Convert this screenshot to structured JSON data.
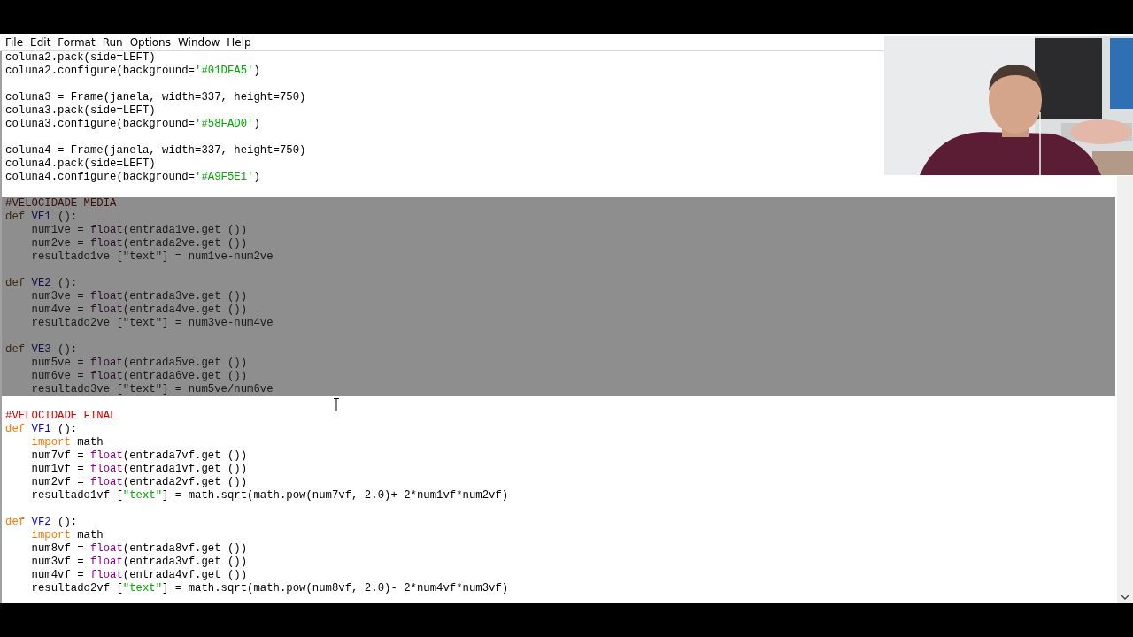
{
  "menu": [
    {
      "label": "File"
    },
    {
      "label": "Edit"
    },
    {
      "label": "Format"
    },
    {
      "label": "Run"
    },
    {
      "label": "Options"
    },
    {
      "label": "Window"
    },
    {
      "label": "Help"
    }
  ],
  "code_lines": [
    {
      "selected": false,
      "tokens": [
        {
          "kind": "plain",
          "text": "coluna2.pack(side=LEFT)"
        }
      ]
    },
    {
      "selected": false,
      "tokens": [
        {
          "kind": "plain",
          "text": "coluna2.configure(background="
        },
        {
          "kind": "string",
          "text": "'#01DFA5'"
        },
        {
          "kind": "plain",
          "text": ")"
        }
      ]
    },
    {
      "selected": false
    },
    {
      "selected": false,
      "tokens": [
        {
          "kind": "plain",
          "text": "coluna3 = Frame(janela, width=337, height=750)"
        }
      ]
    },
    {
      "selected": false,
      "tokens": [
        {
          "kind": "plain",
          "text": "coluna3.pack(side=LEFT)"
        }
      ]
    },
    {
      "selected": false,
      "tokens": [
        {
          "kind": "plain",
          "text": "coluna3.configure(background="
        },
        {
          "kind": "string",
          "text": "'#58FAD0'"
        },
        {
          "kind": "plain",
          "text": ")"
        }
      ]
    },
    {
      "selected": false
    },
    {
      "selected": false,
      "tokens": [
        {
          "kind": "plain",
          "text": "coluna4 = Frame(janela, width=337, height=750)"
        }
      ]
    },
    {
      "selected": false,
      "tokens": [
        {
          "kind": "plain",
          "text": "coluna4.pack(side=LEFT)"
        }
      ]
    },
    {
      "selected": false,
      "tokens": [
        {
          "kind": "plain",
          "text": "coluna4.configure(background="
        },
        {
          "kind": "string",
          "text": "'#A9F5E1'"
        },
        {
          "kind": "plain",
          "text": ")"
        }
      ]
    },
    {
      "selected": false
    },
    {
      "selected": true,
      "tokens": [
        {
          "kind": "comment",
          "text": "#VELOCIDADE MEDIA"
        }
      ]
    },
    {
      "selected": true,
      "tokens": [
        {
          "kind": "keyword",
          "text": "def"
        },
        {
          "kind": "defname",
          "text": " VE1"
        },
        {
          "kind": "plain",
          "text": " ():"
        }
      ]
    },
    {
      "selected": true,
      "tokens": [
        {
          "kind": "plain",
          "text": "    num1ve = "
        },
        {
          "kind": "builtin",
          "text": "float"
        },
        {
          "kind": "plain",
          "text": "(entrada1ve.get ())"
        }
      ]
    },
    {
      "selected": true,
      "tokens": [
        {
          "kind": "plain",
          "text": "    num2ve = "
        },
        {
          "kind": "builtin",
          "text": "float"
        },
        {
          "kind": "plain",
          "text": "(entrada2ve.get ())"
        }
      ]
    },
    {
      "selected": true,
      "tokens": [
        {
          "kind": "plain",
          "text": "    resultado1ve ["
        },
        {
          "kind": "string",
          "text": "\"text\""
        },
        {
          "kind": "plain",
          "text": "] = num1ve-num2ve"
        }
      ]
    },
    {
      "selected": true
    },
    {
      "selected": true,
      "tokens": [
        {
          "kind": "keyword",
          "text": "def"
        },
        {
          "kind": "defname",
          "text": " VE2"
        },
        {
          "kind": "plain",
          "text": " ():"
        }
      ]
    },
    {
      "selected": true,
      "tokens": [
        {
          "kind": "plain",
          "text": "    num3ve = "
        },
        {
          "kind": "builtin",
          "text": "float"
        },
        {
          "kind": "plain",
          "text": "(entrada3ve.get ())"
        }
      ]
    },
    {
      "selected": true,
      "tokens": [
        {
          "kind": "plain",
          "text": "    num4ve = "
        },
        {
          "kind": "builtin",
          "text": "float"
        },
        {
          "kind": "plain",
          "text": "(entrada4ve.get ())"
        }
      ]
    },
    {
      "selected": true,
      "tokens": [
        {
          "kind": "plain",
          "text": "    resultado2ve ["
        },
        {
          "kind": "string",
          "text": "\"text\""
        },
        {
          "kind": "plain",
          "text": "] = num3ve-num4ve"
        }
      ]
    },
    {
      "selected": true
    },
    {
      "selected": true,
      "tokens": [
        {
          "kind": "keyword",
          "text": "def"
        },
        {
          "kind": "defname",
          "text": " VE3"
        },
        {
          "kind": "plain",
          "text": " ():"
        }
      ]
    },
    {
      "selected": true,
      "tokens": [
        {
          "kind": "plain",
          "text": "    num5ve = "
        },
        {
          "kind": "builtin",
          "text": "float"
        },
        {
          "kind": "plain",
          "text": "(entrada5ve.get ())"
        }
      ]
    },
    {
      "selected": true,
      "tokens": [
        {
          "kind": "plain",
          "text": "    num6ve = "
        },
        {
          "kind": "builtin",
          "text": "float"
        },
        {
          "kind": "plain",
          "text": "(entrada6ve.get ())"
        }
      ]
    },
    {
      "selected": true,
      "tokens": [
        {
          "kind": "plain",
          "text": "    resultado3ve ["
        },
        {
          "kind": "string",
          "text": "\"text\""
        },
        {
          "kind": "plain",
          "text": "] = num5ve/num6ve"
        }
      ]
    },
    {
      "selected": false
    },
    {
      "selected": false,
      "tokens": [
        {
          "kind": "comment",
          "text": "#VELOCIDADE FINAL"
        }
      ]
    },
    {
      "selected": false,
      "tokens": [
        {
          "kind": "keyword",
          "text": "def"
        },
        {
          "kind": "defname",
          "text": " VF1"
        },
        {
          "kind": "plain",
          "text": " ():"
        }
      ]
    },
    {
      "selected": false,
      "tokens": [
        {
          "kind": "keyword",
          "text": "    import"
        },
        {
          "kind": "plain",
          "text": " math"
        }
      ]
    },
    {
      "selected": false,
      "tokens": [
        {
          "kind": "plain",
          "text": "    num7vf = "
        },
        {
          "kind": "builtin",
          "text": "float"
        },
        {
          "kind": "plain",
          "text": "(entrada7vf.get ())"
        }
      ]
    },
    {
      "selected": false,
      "tokens": [
        {
          "kind": "plain",
          "text": "    num1vf = "
        },
        {
          "kind": "builtin",
          "text": "float"
        },
        {
          "kind": "plain",
          "text": "(entrada1vf.get ())"
        }
      ]
    },
    {
      "selected": false,
      "tokens": [
        {
          "kind": "plain",
          "text": "    num2vf = "
        },
        {
          "kind": "builtin",
          "text": "float"
        },
        {
          "kind": "plain",
          "text": "(entrada2vf.get ())"
        }
      ]
    },
    {
      "selected": false,
      "tokens": [
        {
          "kind": "plain",
          "text": "    resultado1vf ["
        },
        {
          "kind": "string",
          "text": "\"text\""
        },
        {
          "kind": "plain",
          "text": "] = math.sqrt(math.pow(num7vf, 2.0)+ 2*num1vf*num2vf)"
        }
      ]
    },
    {
      "selected": false
    },
    {
      "selected": false,
      "tokens": [
        {
          "kind": "keyword",
          "text": "def"
        },
        {
          "kind": "defname",
          "text": " VF2"
        },
        {
          "kind": "plain",
          "text": " ():"
        }
      ]
    },
    {
      "selected": false,
      "tokens": [
        {
          "kind": "keyword",
          "text": "    import"
        },
        {
          "kind": "plain",
          "text": " math"
        }
      ]
    },
    {
      "selected": false,
      "tokens": [
        {
          "kind": "plain",
          "text": "    num8vf = "
        },
        {
          "kind": "builtin",
          "text": "float"
        },
        {
          "kind": "plain",
          "text": "(entrada8vf.get ())"
        }
      ]
    },
    {
      "selected": false,
      "tokens": [
        {
          "kind": "plain",
          "text": "    num3vf = "
        },
        {
          "kind": "builtin",
          "text": "float"
        },
        {
          "kind": "plain",
          "text": "(entrada3vf.get ())"
        }
      ]
    },
    {
      "selected": false,
      "tokens": [
        {
          "kind": "plain",
          "text": "    num4vf = "
        },
        {
          "kind": "builtin",
          "text": "float"
        },
        {
          "kind": "plain",
          "text": "(entrada4vf.get ())"
        }
      ]
    },
    {
      "selected": false,
      "tokens": [
        {
          "kind": "plain",
          "text": "    resultado2vf ["
        },
        {
          "kind": "string",
          "text": "\"text\""
        },
        {
          "kind": "plain",
          "text": "] = math.sqrt(math.pow(num8vf, 2.0)- 2*num4vf*num3vf)"
        }
      ]
    }
  ]
}
